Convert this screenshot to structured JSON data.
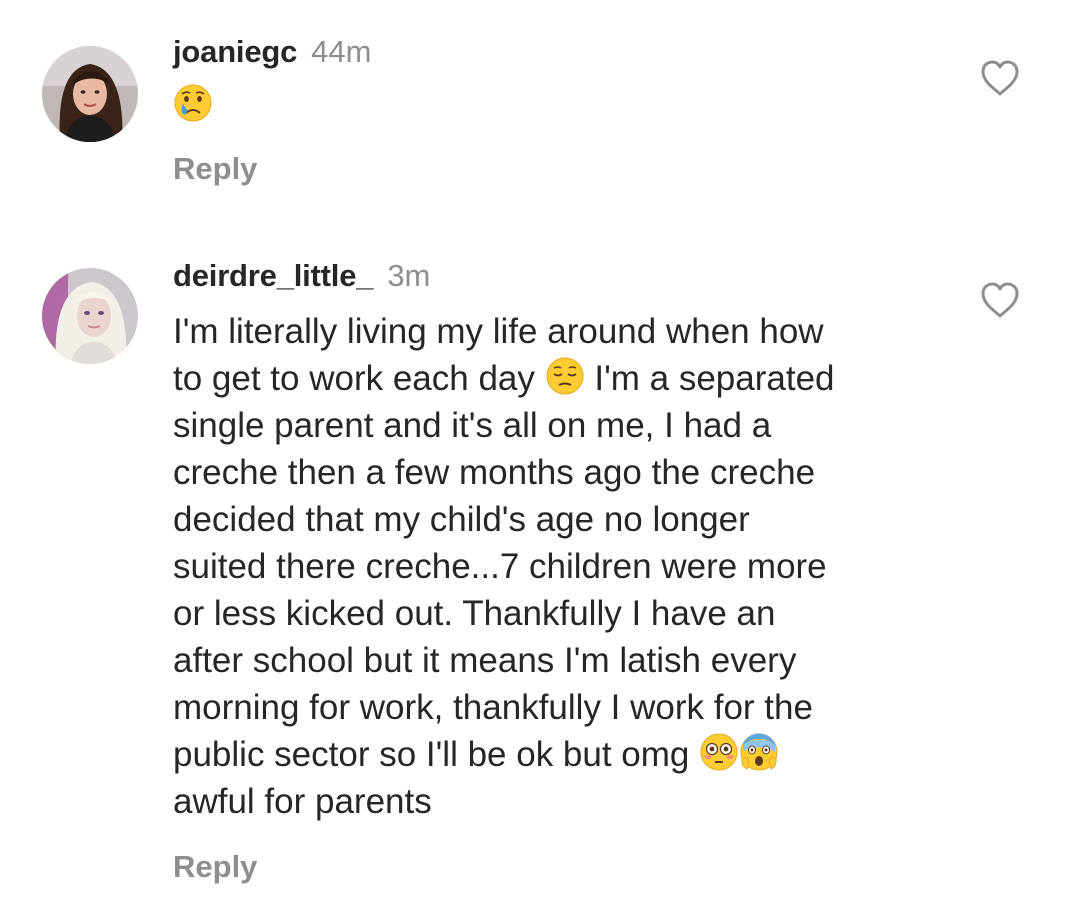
{
  "comments": [
    {
      "username": "joaniegc",
      "time": "44m",
      "text_lines": [],
      "emoji": "crying-face",
      "reply_label": "Reply",
      "like_icon": "heart-outline-icon"
    },
    {
      "username": "deirdre_little_",
      "time": "3m",
      "text_lines": [
        "I'm literally living my life around when how",
        "to get to work each day",
        "I'm a separated",
        "single parent and it's all on me, I had a",
        "creche then a few months ago the creche",
        "decided that my child's age no longer",
        "suited there creche...7 children were more",
        "or less kicked out. Thankfully I have an",
        "after school but it means I'm latish every",
        "morning for work, thankfully I work for the",
        "public sector so I'll be ok but omg",
        "awful for parents"
      ],
      "emojis": [
        "pensive-face",
        "flushed-face",
        "screaming-face"
      ],
      "reply_label": "Reply",
      "like_icon": "heart-outline-icon"
    }
  ],
  "colors": {
    "text": "#262626",
    "secondary": "#8e8e8e",
    "background": "#ffffff"
  }
}
